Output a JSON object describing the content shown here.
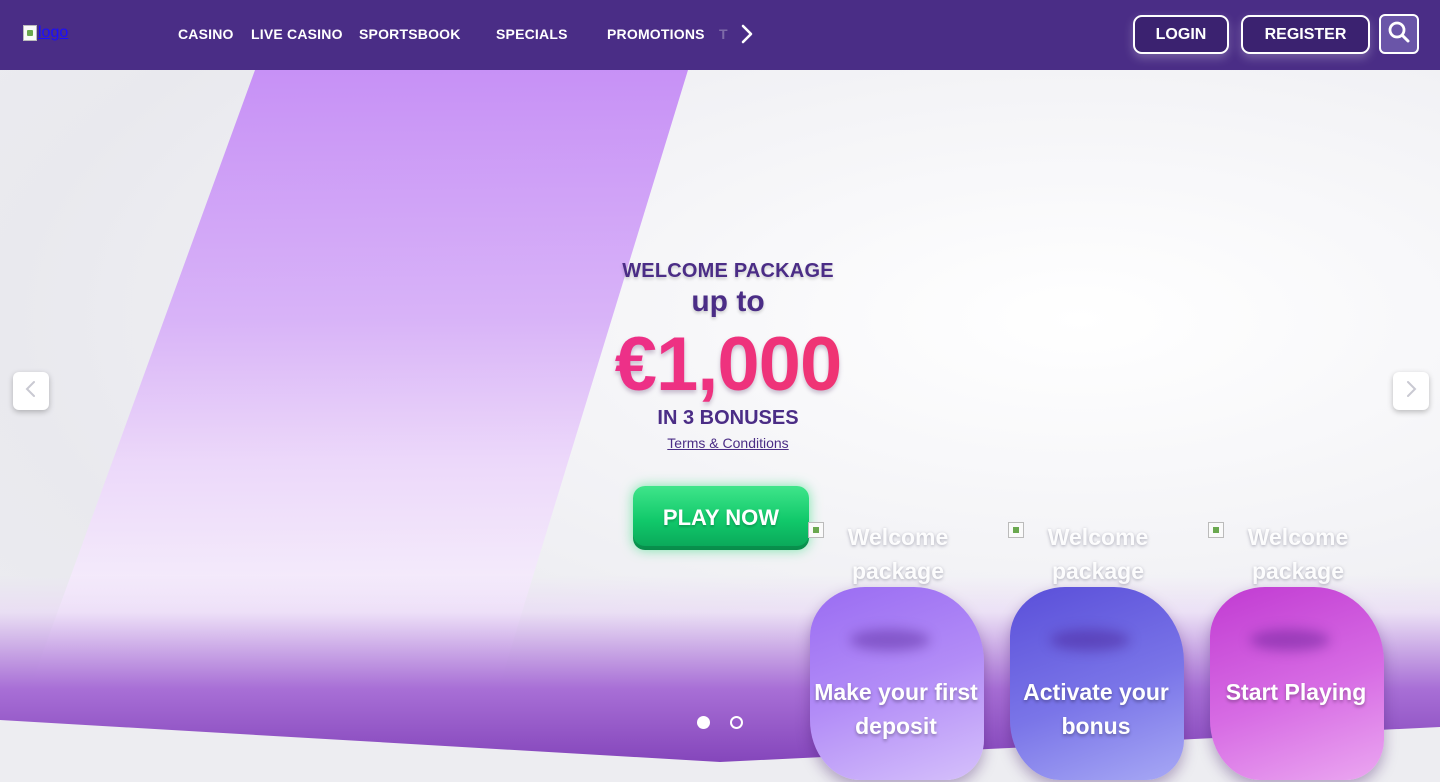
{
  "header": {
    "logo_alt": "logo",
    "nav": [
      "CASINO",
      "LIVE CASINO",
      "SPORTSBOOK",
      "SPECIALS",
      "PROMOTIONS"
    ],
    "nav_more_partial": "T",
    "login_label": "LOGIN",
    "register_label": "REGISTER",
    "colors": {
      "bar": "#4a2d86",
      "accent_text": "#ffffff"
    }
  },
  "hero": {
    "welcome": "WELCOME PACKAGE",
    "upto": "up to",
    "amount": "€1,000",
    "bonuses": "IN 3 BONUSES",
    "terms": "Terms & Conditions",
    "cta": "PLAY NOW",
    "colors": {
      "amount": "#ec2f8e",
      "cta": "#10c86a",
      "text": "#4b2d86"
    },
    "slides": {
      "count": 2,
      "active": 1
    }
  },
  "steps": [
    {
      "image_alt": "Welcome package",
      "label": "Make your first deposit"
    },
    {
      "image_alt": "Welcome package",
      "label": "Activate your bonus"
    },
    {
      "image_alt": "Welcome package",
      "label": "Start Playing"
    }
  ],
  "icons": [
    "chevron-right-icon",
    "search-icon",
    "chevron-left-icon",
    "broken-image-icon"
  ]
}
